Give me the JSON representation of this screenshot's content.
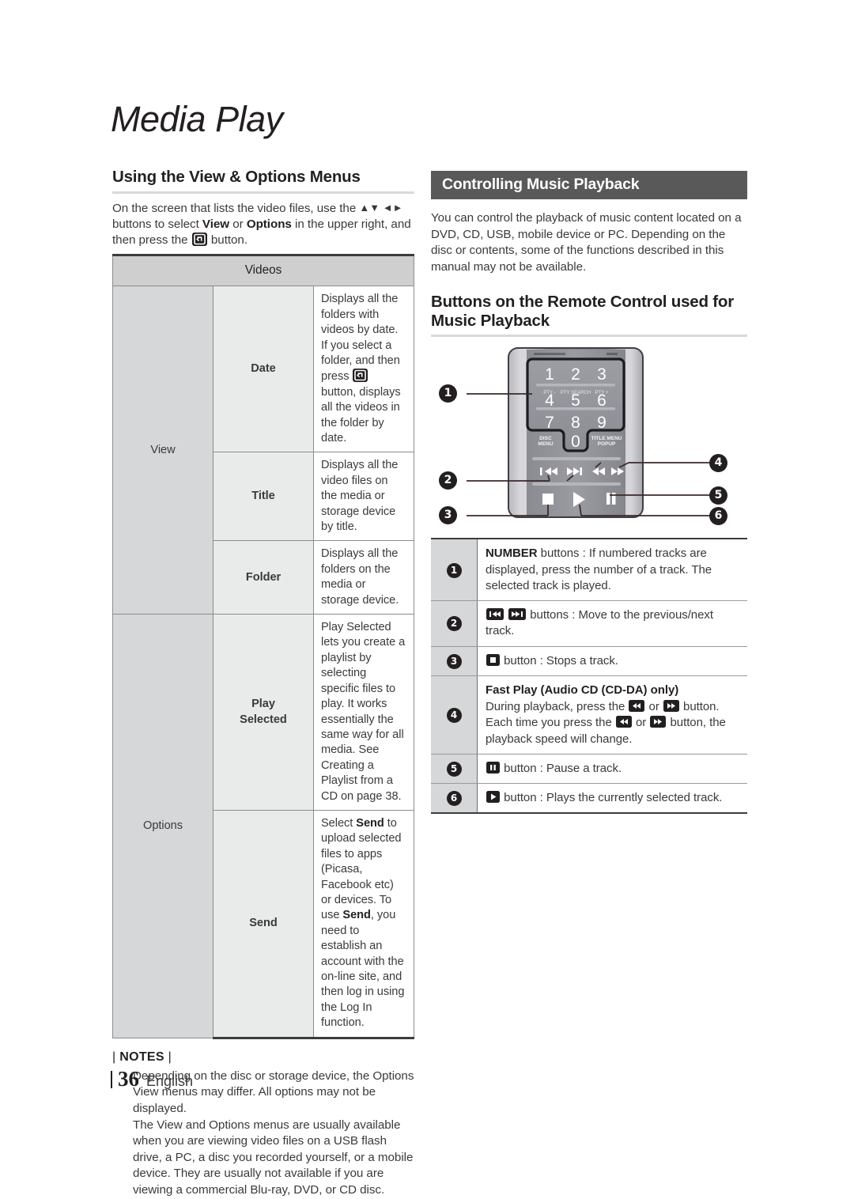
{
  "chapter": {
    "title": "Media Play"
  },
  "left": {
    "section_heading": "Using the View & Options Menus",
    "intro_1": "On the screen that lists the video files, use the ",
    "intro_arrows": "▲▼ ◄►",
    "intro_2": " buttons to select ",
    "intro_view": "View",
    "intro_or": " or ",
    "intro_options": "Options",
    "intro_3": " in the upper right, and then press the ",
    "intro_4": " button.",
    "table": {
      "header": "Videos",
      "rows": [
        {
          "group": "View",
          "group_rowspan": 3,
          "items": [
            {
              "name": "Date",
              "desc_1": "Displays all the folders with videos by date. If you select a folder, and then press ",
              "has_icon": true,
              "desc_2": " button, displays all the videos in the folder by date."
            },
            {
              "name": "Title",
              "desc_1": "Displays all the video files on the media or storage device by title.",
              "has_icon": false,
              "desc_2": ""
            },
            {
              "name": "Folder",
              "desc_1": "Displays all the folders on the media or storage device.",
              "has_icon": false,
              "desc_2": ""
            }
          ]
        },
        {
          "group": "Options",
          "group_rowspan": 2,
          "items": [
            {
              "name": "Play Selected",
              "name_line1": "Play",
              "name_line2": "Selected",
              "desc_1": "Play Selected lets you create a playlist by selecting specific files to play. It works essentially the same way for all media. See Creating a Playlist from a CD on page 38.",
              "has_icon": false,
              "desc_2": ""
            },
            {
              "name": "Send",
              "desc_parts": [
                {
                  "text": "Select ",
                  "bold": false
                },
                {
                  "text": "Send",
                  "bold": true
                },
                {
                  "text": " to upload selected files to apps (Picasa, Facebook etc) or devices. To use ",
                  "bold": false
                },
                {
                  "text": "Send",
                  "bold": true
                },
                {
                  "text": ", you need to establish an account with the on-line site, and then log in using the Log In function.",
                  "bold": false
                }
              ]
            }
          ]
        }
      ]
    },
    "notes_title": "NOTES",
    "notes": [
      "Depending on the disc or storage device, the Options View menus may differ. All options may not be displayed.",
      "The View and Options menus are usually available when you are viewing video files on a USB flash drive, a PC, a disc you recorded yourself, or a mobile device. They are usually not available if you are viewing a commercial Blu-ray, DVD, or CD disc."
    ]
  },
  "right": {
    "bar_heading": "Controlling Music Playback",
    "intro": "You can control the playback of music content located on a DVD, CD, USB, mobile device or PC. Depending on the disc or contents, some of the functions described in this manual may not be available.",
    "section_heading": "Buttons on the Remote Control used for Music Playback",
    "remote": {
      "numbers": [
        "1",
        "2",
        "3",
        "4",
        "5",
        "6",
        "7",
        "8",
        "9",
        "0"
      ],
      "labels": {
        "pty_minus": "PTY -",
        "pty_search": "PTY SEARCH",
        "pty_plus": "PTY +",
        "disc_menu_1": "DISC",
        "disc_menu_2": "MENU",
        "title_menu_1": "TITLE MENU",
        "title_menu_2": "POPUP"
      },
      "callouts": [
        "1",
        "2",
        "3",
        "4",
        "5",
        "6"
      ]
    },
    "button_table": [
      {
        "num": "1",
        "parts": [
          {
            "text": "NUMBER",
            "bold": true
          },
          {
            "text": " buttons : If numbered tracks are displayed, press the number of a track. The selected track is played.",
            "bold": false
          }
        ]
      },
      {
        "num": "2",
        "icons": [
          "prev",
          "next"
        ],
        "text": " buttons : Move to the previous/next track."
      },
      {
        "num": "3",
        "icons": [
          "stop"
        ],
        "text": " button : Stops a track."
      },
      {
        "num": "4",
        "subtitle": "Fast Play (Audio CD (CD-DA) only)",
        "line_a_1": "During playback, press the ",
        "line_a_2": " or ",
        "line_a_3": " button.",
        "line_b_1": "Each time you press the ",
        "line_b_2": " or ",
        "line_b_3": " button, the playback speed will change."
      },
      {
        "num": "5",
        "icons": [
          "pause"
        ],
        "text": " button : Pause a track."
      },
      {
        "num": "6",
        "icons": [
          "play"
        ],
        "text": " button : Plays the currently selected track."
      }
    ]
  },
  "footer": {
    "page_number": "36",
    "language": "English"
  },
  "colors": {
    "bar_heading_bg": "#595959",
    "table_header_bg": "#cfcfcf",
    "group_cell_bg": "#d5d7d8",
    "item_cell_bg": "#e9eaea",
    "text": "#3a3a3a",
    "heading_text": "#231f20"
  }
}
